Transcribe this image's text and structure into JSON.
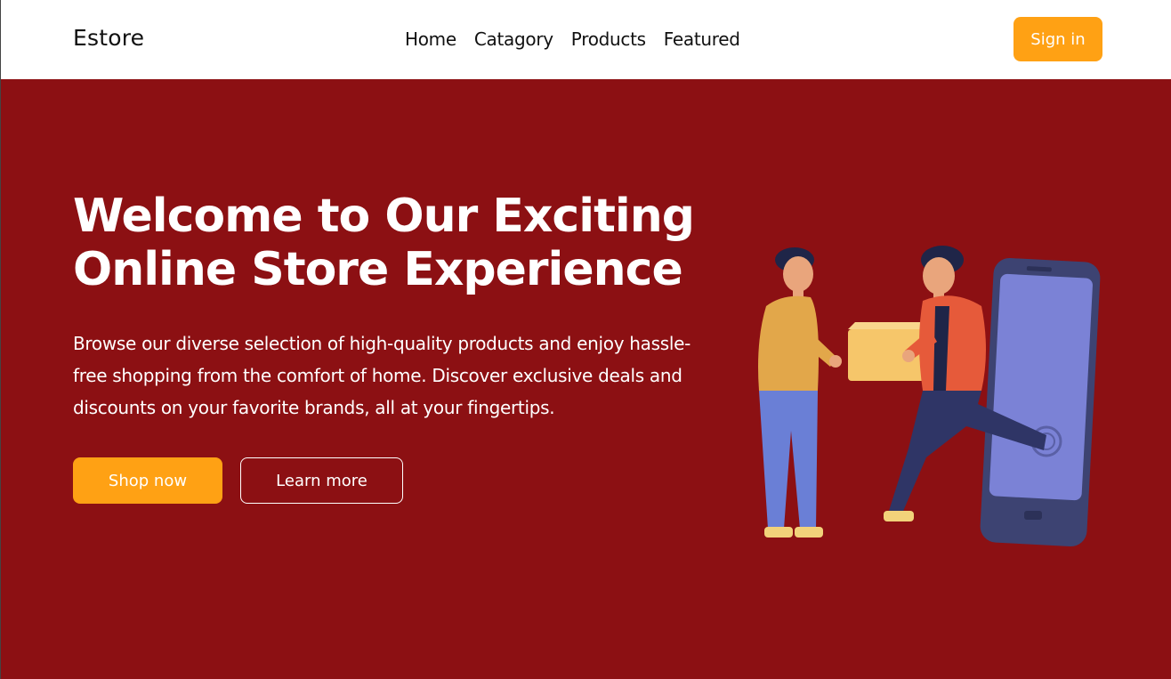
{
  "navbar": {
    "brand": "Estore",
    "links": [
      "Home",
      "Catagory",
      "Products",
      "Featured"
    ],
    "signin_label": "Sign in"
  },
  "hero": {
    "headline": "Welcome to Our Exciting Online Store Experience",
    "description": "Browse our diverse selection of high-quality products and enjoy hassle-free shopping from the comfort of home. Discover exclusive deals and discounts on your favorite brands, all at your fingertips.",
    "shop_label": "Shop now",
    "learn_label": "Learn more"
  },
  "colors": {
    "hero_bg": "#8c1013",
    "accent": "#ffa114",
    "navbar_bg": "#ffffff"
  },
  "icons": {
    "illustration": "delivery-handoff-phone-illustration"
  }
}
